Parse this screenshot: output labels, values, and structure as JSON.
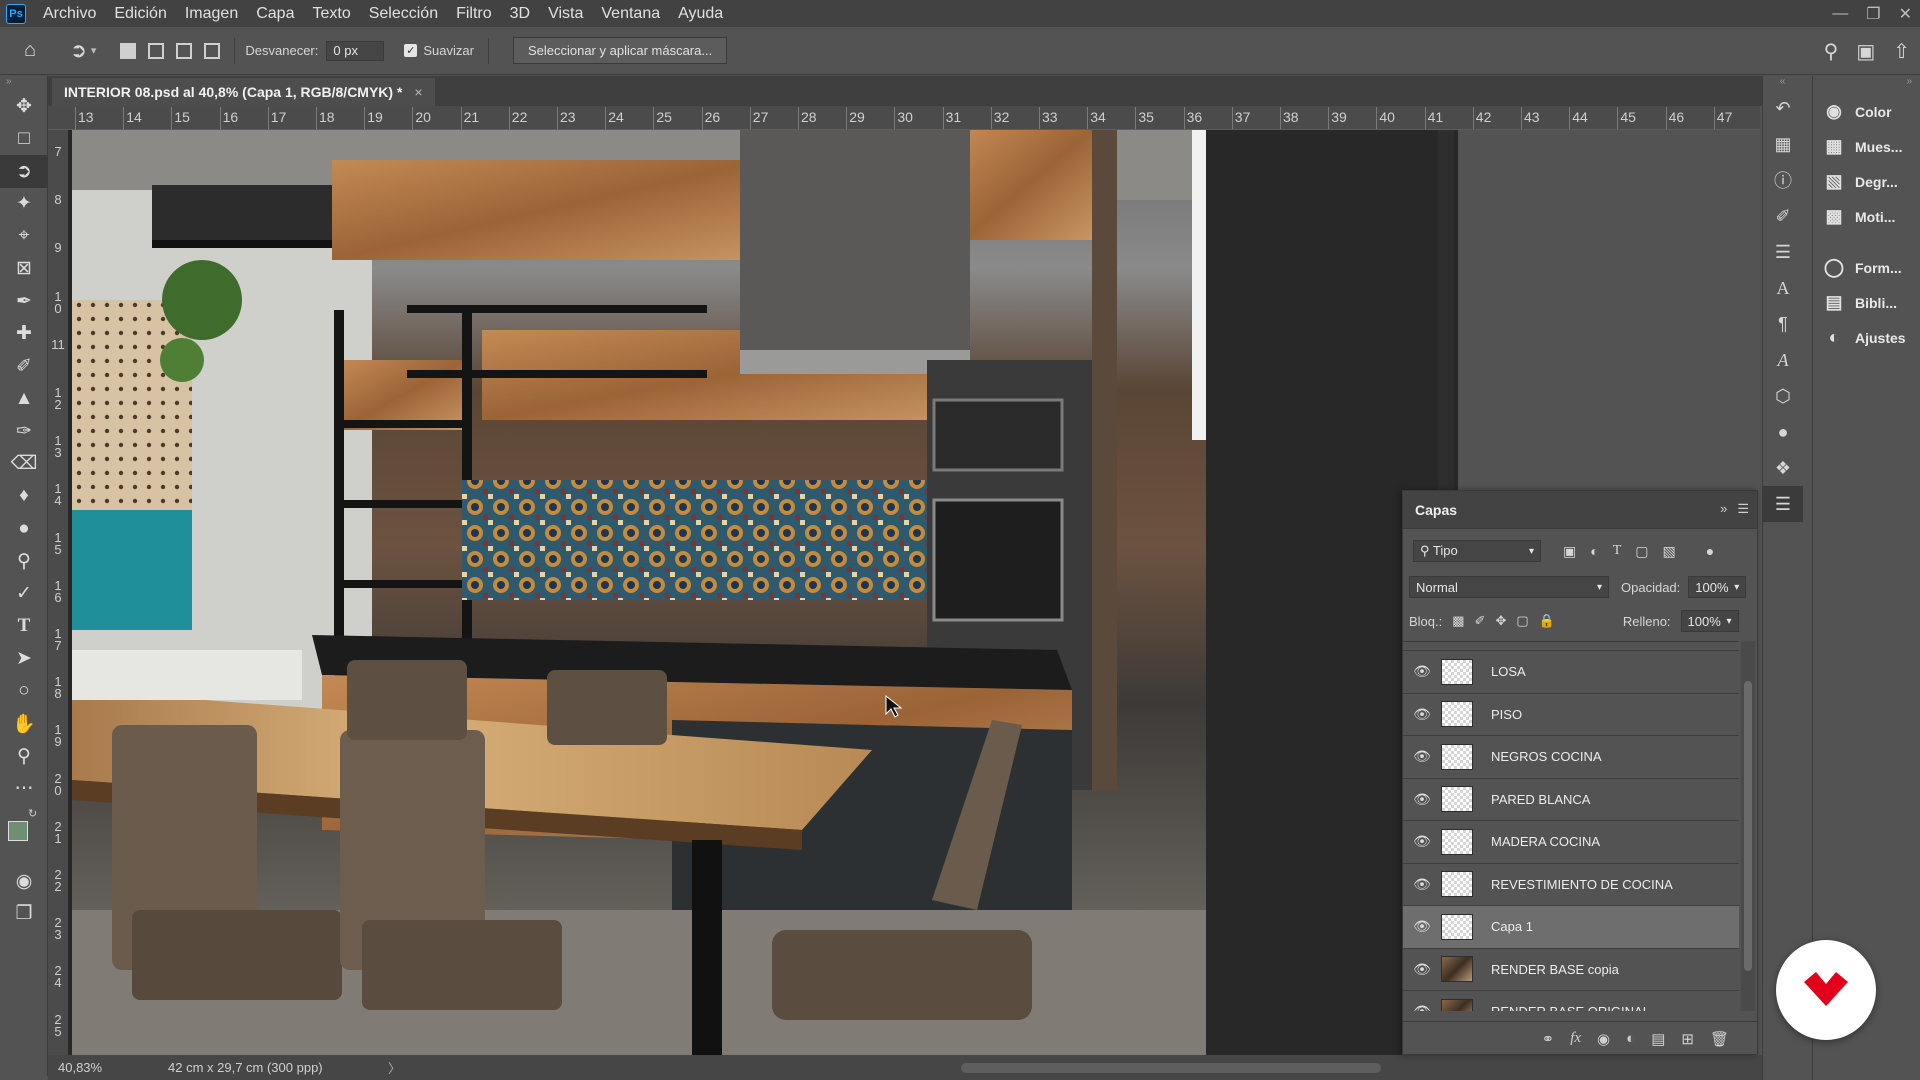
{
  "menubar": {
    "app_icon": "Ps",
    "items": [
      "Archivo",
      "Edición",
      "Imagen",
      "Capa",
      "Texto",
      "Selección",
      "Filtro",
      "3D",
      "Vista",
      "Ventana",
      "Ayuda"
    ],
    "window_controls": [
      "minimize-icon",
      "restore-icon",
      "close-icon"
    ]
  },
  "options": {
    "feather_label": "Desvanecer:",
    "feather_value": "0 px",
    "smooth_label": "Suavizar",
    "smooth_checked": true,
    "mask_button": "Seleccionar y aplicar máscara..."
  },
  "document": {
    "tab_title": "INTERIOR 08.psd al 40,8% (Capa 1, RGB/8/CMYK) *",
    "close_glyph": "×"
  },
  "ruler_h": [
    "13",
    "14",
    "15",
    "16",
    "17",
    "18",
    "19",
    "20",
    "21",
    "22",
    "23",
    "24",
    "25",
    "26",
    "27",
    "28",
    "29",
    "30",
    "31",
    "32",
    "33",
    "34",
    "35",
    "36",
    "37",
    "38",
    "39",
    "40",
    "41",
    "42",
    "43",
    "44",
    "45",
    "46",
    "47"
  ],
  "ruler_v": [
    "7",
    "8",
    "9",
    "10",
    "11",
    "12",
    "13",
    "14",
    "15",
    "16",
    "17",
    "18",
    "19",
    "20",
    "21",
    "22",
    "23",
    "24",
    "25"
  ],
  "status": {
    "zoom": "40,83%",
    "doc_size": "42 cm x 29,7 cm (300 ppp)",
    "arrow": "〉"
  },
  "tools": [
    "move-tool",
    "marquee-tool",
    "lasso-tool",
    "magic-wand-tool",
    "crop-tool",
    "frame-tool",
    "eyedropper-tool",
    "healing-tool",
    "brush-tool",
    "stamp-tool",
    "history-brush-tool",
    "eraser-tool",
    "paint-bucket-tool",
    "blur-tool",
    "dodge-tool",
    "pen-tool",
    "type-tool",
    "path-selection-tool",
    "shape-tool",
    "hand-tool",
    "zoom-tool",
    "more-tools"
  ],
  "colors": {
    "foreground": "#6f8f75",
    "background": "#f2d4b8",
    "accent": "#31a8ff",
    "brand": "#e2001a"
  },
  "right_panels": [
    {
      "icon": "color-icon",
      "label": "Color"
    },
    {
      "icon": "swatches-icon",
      "label": "Mues..."
    },
    {
      "icon": "gradient-icon",
      "label": "Degr..."
    },
    {
      "icon": "patterns-icon",
      "label": "Moti..."
    },
    {
      "icon": "shapes-icon",
      "label": "Form..."
    },
    {
      "icon": "libraries-icon",
      "label": "Bibli..."
    },
    {
      "icon": "adjustments-icon",
      "label": "Ajustes"
    }
  ],
  "layers": {
    "title": "Capas",
    "filter_kind": "Tipo",
    "blend_mode": "Normal",
    "opacity_label": "Opacidad:",
    "opacity": "100%",
    "lock_label": "Bloq.:",
    "fill_label": "Relleno:",
    "fill": "100%",
    "items": [
      {
        "name": "LOSA",
        "selected": false,
        "photo": false
      },
      {
        "name": "PISO",
        "selected": false,
        "photo": false
      },
      {
        "name": "NEGROS COCINA",
        "selected": false,
        "photo": false
      },
      {
        "name": "PARED BLANCA",
        "selected": false,
        "photo": false
      },
      {
        "name": "MADERA COCINA",
        "selected": false,
        "photo": false
      },
      {
        "name": "REVESTIMIENTO DE COCINA",
        "selected": false,
        "photo": false
      },
      {
        "name": "Capa 1",
        "selected": true,
        "photo": false
      },
      {
        "name": "RENDER BASE copia",
        "selected": false,
        "photo": true
      },
      {
        "name": "RENDER BASE ORIGINAL",
        "selected": false,
        "photo": true
      }
    ]
  }
}
